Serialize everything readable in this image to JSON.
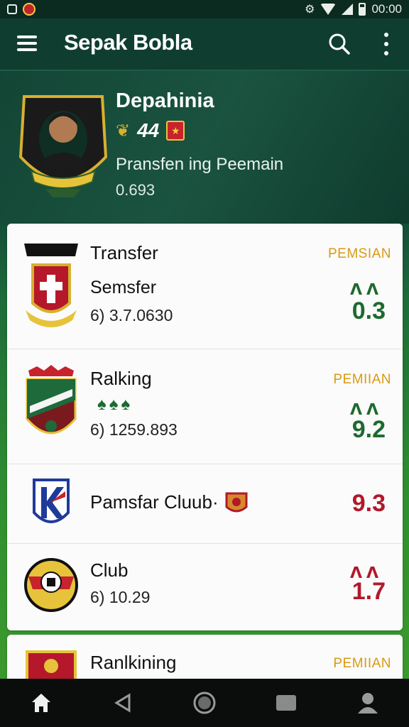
{
  "status_bar": {
    "time": "00:00"
  },
  "app_bar": {
    "title": "Sepak Bobla"
  },
  "profile": {
    "name": "Depahinia",
    "number_badge": "44",
    "subtitle": "Pransfen ing Peemain",
    "value": "0.693"
  },
  "rows": [
    {
      "title": "Transfer",
      "subtitle": "Semsfer",
      "meta": "6) 3.7.0630",
      "tag": "PEMSIAN",
      "score": "0.3",
      "arrows": "ᐱᐱ",
      "score_color": "green"
    },
    {
      "title": "Ralking",
      "meta": "6) 1259.893",
      "tag": "PEMIIAN",
      "score": "9.2",
      "arrows": "ᐱᐱ",
      "score_color": "green"
    },
    {
      "title": "Pamsfar Cluub·",
      "score": "9.3",
      "score_color": "red"
    },
    {
      "title": "Club",
      "meta": "6)  10.29",
      "score": "1.7",
      "arrows": "ᐱᐱ",
      "score_color": "red"
    },
    {
      "title": "Ranlkining",
      "tag": "PEMIIAN"
    }
  ],
  "colors": {
    "brand": "#0f3e30",
    "accent_green": "#1d6a2e",
    "accent_red": "#b0192a",
    "tag_gold": "#d99a14"
  },
  "icons": [
    "menu-icon",
    "search-icon",
    "more-icon",
    "home-icon",
    "back-icon",
    "home-circle-icon",
    "recents-icon",
    "profile-icon"
  ]
}
